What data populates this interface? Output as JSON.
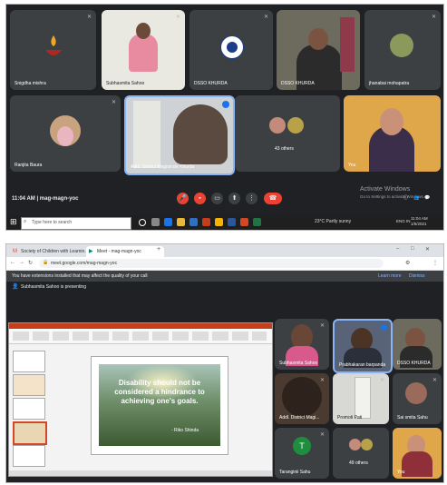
{
  "top_meet": {
    "participants": [
      {
        "name": "Snigdha mishra"
      },
      {
        "name": "Subhasmita Sahoo"
      },
      {
        "name": "DSSO KHURDA"
      },
      {
        "name": "DSSO KHURDA"
      },
      {
        "name": "jhanabai mohapatra"
      },
      {
        "name": "Ranjita Baura"
      },
      {
        "name": "Addl. District Magistrate Khurda"
      },
      {
        "name": "43 others"
      },
      {
        "name": "You"
      }
    ],
    "meeting_info": "11:04 AM | mag-magn-yoc",
    "activate": {
      "line1": "Activate Windows",
      "line2": "Go to Settings to activate Windows."
    },
    "taskbar": {
      "search_placeholder": "Type here to search",
      "weather": "23°C  Partly sunny",
      "lang": "ENG IN",
      "clock": "11:04 AM 1/5/2021"
    }
  },
  "bottom_meet": {
    "tabs": [
      "Society of Children with Learnin...",
      "Meet - mag-magn-yoc"
    ],
    "url": "meet.google.com/mag-magn-yoc",
    "banner_text": "You have extensions installed that may affect the quality of your call",
    "banner_learn": "Learn more",
    "banner_dismiss": "Dismiss",
    "presenting": "Subhasmita Sahoo is presenting",
    "slide_text": "Disability should not be considered a hindrance to achieving one's goals.",
    "slide_credit": "- Riko Shinda",
    "participants": [
      {
        "name": "Subhasmita Sahoo"
      },
      {
        "name": "Prabhakaran barpanda"
      },
      {
        "name": "DSSO KHURDA"
      },
      {
        "name": "Addl. District Magi..."
      },
      {
        "name": "Promoti Pati"
      },
      {
        "name": "Sai smita Sahu"
      },
      {
        "name": "Taranginii Sahu",
        "initial": "T"
      },
      {
        "name": "49 others"
      },
      {
        "name": "You"
      }
    ]
  },
  "colors": {
    "meet_bg": "#202124",
    "tile_bg": "#3c4043",
    "end_call": "#ea4335",
    "accent": "#8ab4f8",
    "avatar_green": "#1e8e3e"
  }
}
